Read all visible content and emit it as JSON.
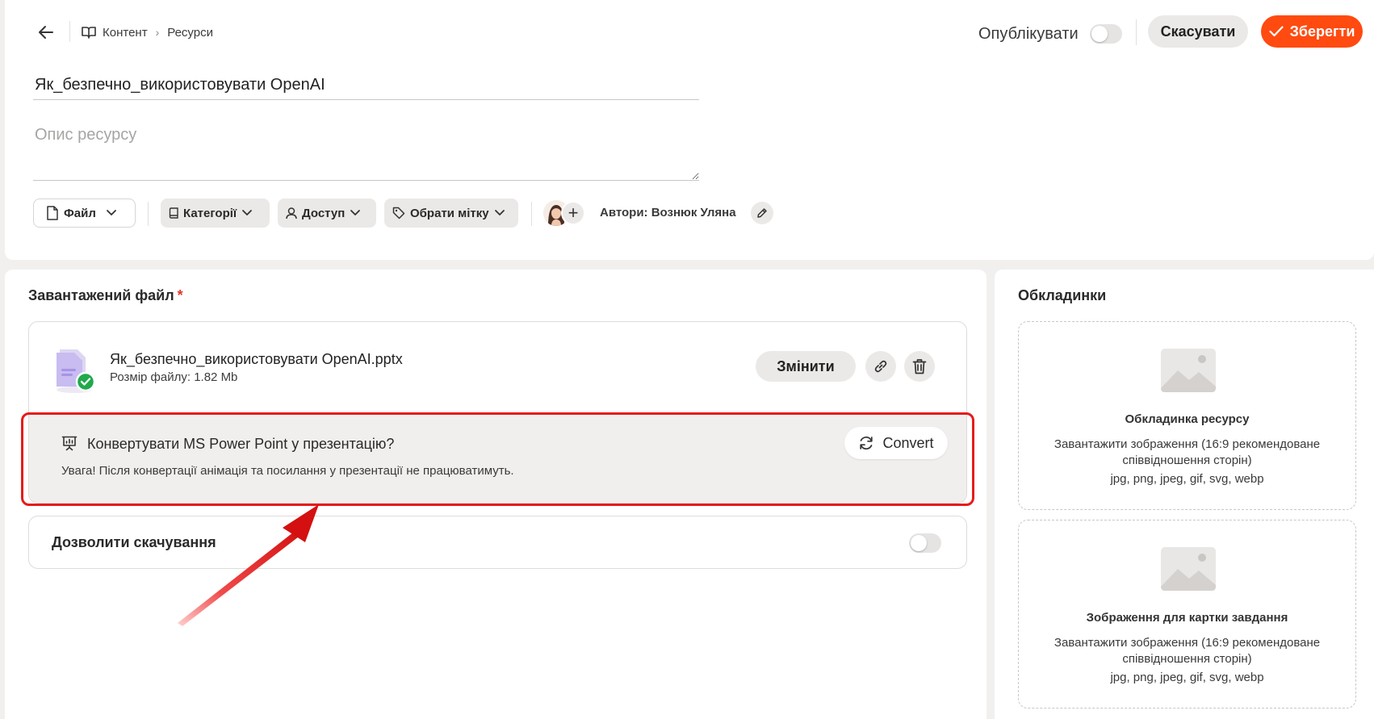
{
  "header": {
    "breadcrumb": [
      "Контент",
      "Ресурси"
    ],
    "publish_label": "Опублікувати",
    "publish_on": false,
    "cancel_label": "Скасувати",
    "save_label": "Зберегти"
  },
  "resource": {
    "title_value": "Як_безпечно_використовувати OpenAI",
    "description_placeholder": "Опис ресурсу"
  },
  "toolbar": {
    "file_label": "Файл",
    "categories_label": "Категорії",
    "access_label": "Доступ",
    "tag_label": "Обрати мітку",
    "authors_text": "Автори: Вознюк Уляна"
  },
  "upload": {
    "section_title": "Завантажений файл",
    "required_mark": "*",
    "file_name": "Як_безпечно_використовувати OpenAI.pptx",
    "file_size": "Розмір файлу: 1.82 Mb",
    "change_label": "Змінити",
    "convert_title": "Конвертувати MS Power Point у презентацію?",
    "convert_warning": "Увага! Після конвертації анімація та посилання у презентації не працюватимуть.",
    "convert_label": "Convert",
    "allow_download_label": "Дозволити скачування",
    "allow_download_on": false
  },
  "covers": {
    "section_title": "Обкладинки",
    "items": [
      {
        "title": "Обкладинка ресурсу",
        "description": "Завантажити зображення (16:9 рекомендоване співвідношення сторін)",
        "formats": "jpg, png, jpeg, gif, svg, webp"
      },
      {
        "title": "Зображення для картки завдання",
        "description": "Завантажити зображення (16:9 рекомендоване співвідношення сторін)",
        "formats": "jpg, png, jpeg, gif, svg, webp"
      }
    ]
  },
  "colors": {
    "accent": "#ff4a10",
    "highlight": "#e61b1b",
    "success": "#1faa4b"
  }
}
